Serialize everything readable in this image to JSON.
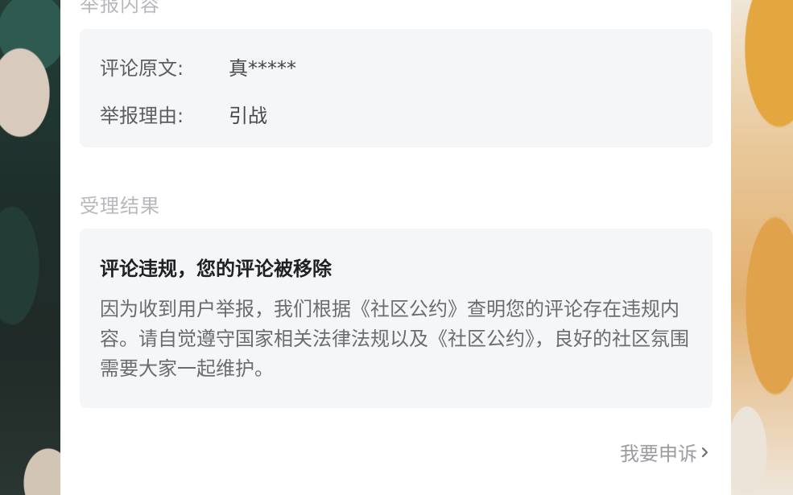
{
  "report_section": {
    "label": "举报内容",
    "comment_key": "评论原文:",
    "comment_value": "真*****",
    "reason_key": "举报理由:",
    "reason_value": "引战"
  },
  "result_section": {
    "label": "受理结果",
    "title": "评论违规，您的评论被移除",
    "body": "因为收到用户举报，我们根据《社区公约》查明您的评论存在违规内容。请自觉遵守国家相关法律法规以及《社区公约》，良好的社区氛围需要大家一起维护。"
  },
  "appeal": {
    "label": "我要申诉",
    "icon": "chevron-right-icon"
  }
}
